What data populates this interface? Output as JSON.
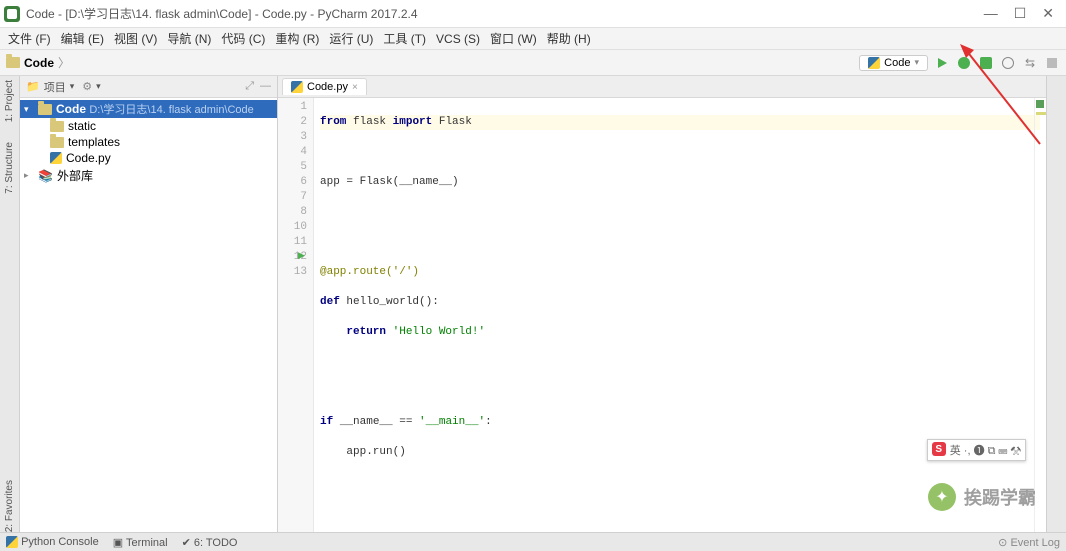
{
  "window": {
    "title": "Code - [D:\\学习日志\\14. flask admin\\Code] - Code.py - PyCharm 2017.2.4"
  },
  "menu": {
    "file": "文件 (F)",
    "edit": "编辑 (E)",
    "view": "视图 (V)",
    "navigate": "导航 (N)",
    "code": "代码 (C)",
    "refactor": "重构 (R)",
    "run": "运行 (U)",
    "tools": "工具 (T)",
    "vcs": "VCS (S)",
    "window": "窗口 (W)",
    "help": "帮助 (H)"
  },
  "breadcrumb": {
    "root": "Code"
  },
  "runconfig": {
    "label": "Code"
  },
  "leftTabs": {
    "project": "1: Project",
    "structure": "7: Structure",
    "favorites": "2: Favorites"
  },
  "projectPanel": {
    "title": "项目"
  },
  "tree": {
    "root": {
      "name": "Code",
      "path": "D:\\学习日志\\14. flask admin\\Code"
    },
    "static": "static",
    "templates": "templates",
    "codepy": "Code.py",
    "external": "外部库"
  },
  "editor": {
    "tab": "Code.py",
    "lines": {
      "l1a": "from",
      "l1b": "flask",
      "l1c": "import",
      "l1d": "Flask",
      "l3": "app = Flask(__name__)",
      "l6": "@app.route('/')",
      "l7a": "def",
      "l7b": "hello_world():",
      "l8a": "return",
      "l8b": "'Hello World!'",
      "l11a": "if",
      "l11b": "__name__ ==",
      "l11c": "'__main__'",
      "l11d": ":",
      "l12": "app.run()"
    },
    "lineNumbers": [
      "1",
      "2",
      "3",
      "4",
      "5",
      "6",
      "7",
      "8",
      "",
      "10",
      "11",
      "12",
      "13"
    ]
  },
  "bottom": {
    "pyconsole": "Python Console",
    "terminal": "Terminal",
    "todo": "6: TODO",
    "eventlog": "Event Log"
  },
  "ime": {
    "text": "英 ·, ➊ ⧉ ⌨ ⚒"
  },
  "watermark": {
    "text": "挨踢学霸"
  }
}
